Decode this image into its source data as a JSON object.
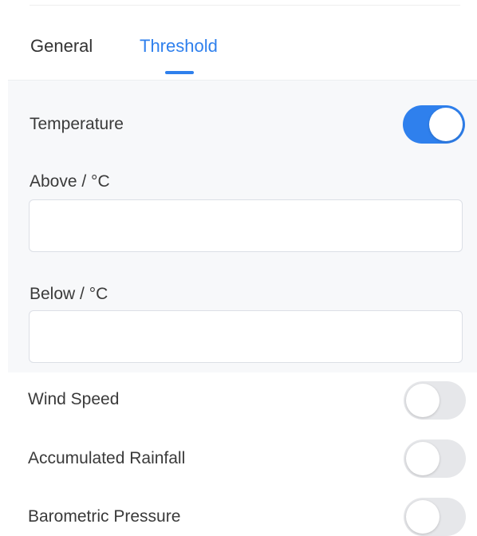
{
  "tabs": {
    "items": [
      {
        "label": "General",
        "active": false
      },
      {
        "label": "Threshold",
        "active": true
      }
    ],
    "active_color": "#2f80ed"
  },
  "temperature": {
    "label": "Temperature",
    "enabled": true,
    "above": {
      "label": "Above / °C",
      "value": ""
    },
    "below": {
      "label": "Below / °C",
      "value": ""
    }
  },
  "wind_speed": {
    "label": "Wind Speed",
    "enabled": false
  },
  "accumulated_rainfall": {
    "label": "Accumulated Rainfall",
    "enabled": false
  },
  "barometric_pressure": {
    "label": "Barometric Pressure",
    "enabled": false
  }
}
